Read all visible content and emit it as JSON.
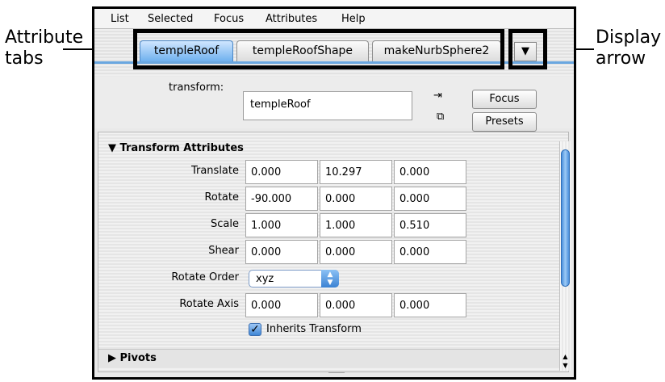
{
  "menubar": {
    "items": [
      "List",
      "Selected",
      "Focus",
      "Attributes",
      "Help"
    ]
  },
  "tabs": [
    "templeRoof",
    "templeRoofShape",
    "makeNurbSphere2"
  ],
  "display_arrow_glyph": "▼",
  "transform": {
    "label": "transform:",
    "value": "templeRoof",
    "focus_button": "Focus",
    "presets_button": "Presets",
    "icon_load": "load-attributes-icon",
    "icon_copy": "copy-tab-icon"
  },
  "section": {
    "header": "Transform Attributes",
    "rows": [
      {
        "label": "Translate",
        "values": [
          "0.000",
          "10.297",
          "0.000"
        ]
      },
      {
        "label": "Rotate",
        "values": [
          "-90.000",
          "0.000",
          "0.000"
        ]
      },
      {
        "label": "Scale",
        "values": [
          "1.000",
          "1.000",
          "0.510"
        ]
      },
      {
        "label": "Shear",
        "values": [
          "0.000",
          "0.000",
          "0.000"
        ]
      }
    ],
    "rotate_order_label": "Rotate Order",
    "rotate_order_value": "xyz",
    "rotate_axis_label": "Rotate Axis",
    "rotate_axis_values": [
      "0.000",
      "0.000",
      "0.000"
    ],
    "inherits_label": "Inherits Transform",
    "inherits_checked": true
  },
  "pivots": {
    "label": "Pivots"
  },
  "callouts": {
    "attribute_tabs": [
      "Attribute",
      "tabs"
    ],
    "display_arrow": [
      "Display",
      "arrow"
    ]
  },
  "colors": {
    "accent": "#6fb0ee",
    "highlight_border": "#000000"
  }
}
